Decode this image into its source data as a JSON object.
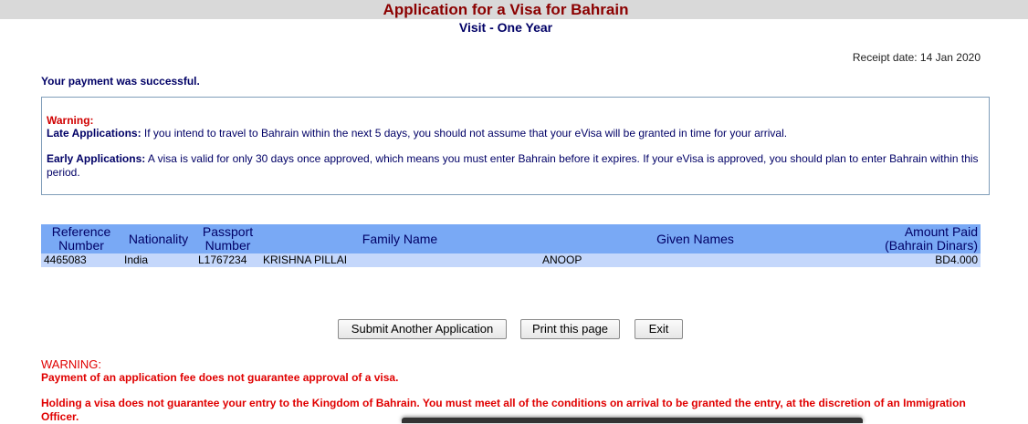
{
  "header": {
    "title": "Application for a Visa for Bahrain",
    "subtitle": "Visit - One Year"
  },
  "receipt": {
    "text": "Receipt date: 14 Jan 2020"
  },
  "status": {
    "message": "Your payment was successful."
  },
  "warning_box": {
    "title": "Warning:",
    "late_label": "Late Applications:",
    "late_text": " If you intend to travel to Bahrain within the next 5 days, you should not assume that your eVisa will be granted in time for your arrival.",
    "early_label": "Early Applications:",
    "early_text": " A visa is valid for only 30 days once approved, which means you must enter Bahrain before it expires. If your eVisa is approved, you should plan to enter Bahrain within this period."
  },
  "table": {
    "headers": {
      "reference": "Reference Number",
      "nationality": "Nationality",
      "passport": "Passport Number",
      "family": "Family Name",
      "given": "Given Names",
      "amount": "Amount Paid (Bahrain Dinars)"
    },
    "rows": [
      {
        "reference": "4465083",
        "nationality": "India",
        "passport": "L1767234",
        "family": "KRISHNA PILLAI",
        "given": "ANOOP",
        "amount": "BD4.000"
      }
    ]
  },
  "buttons": {
    "submit_another": "Submit Another Application",
    "print": "Print this page",
    "exit": "Exit"
  },
  "bottom_warning": {
    "head": "WARNING:",
    "line1": "Payment of an application fee does not guarantee approval of a visa.",
    "line2": "Holding a visa does not guarantee your entry to the Kingdom of Bahrain. You must meet all of the conditions on arrival to be granted the entry, at the discretion of an Immigration Officer."
  },
  "colors": {
    "title": "#8b0000",
    "navy": "#000066",
    "warning_red": "#e00000",
    "table_header_bg": "#79a9f5",
    "table_row_bg": "#c4d7fb"
  }
}
